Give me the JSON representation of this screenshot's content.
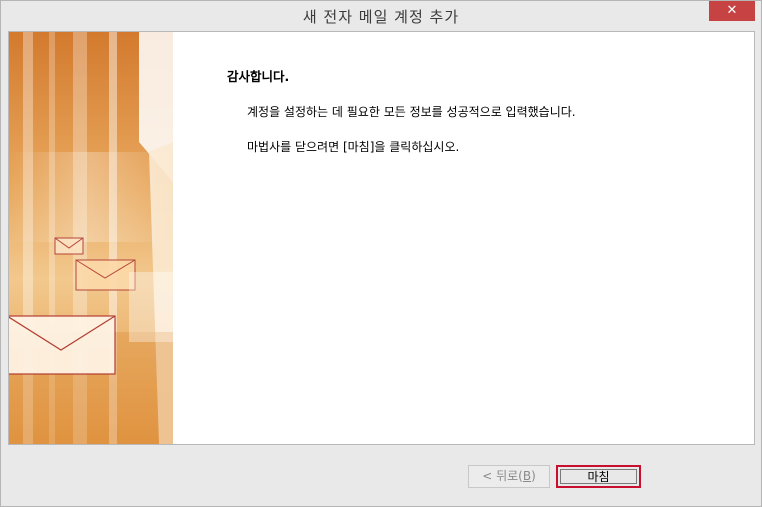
{
  "window": {
    "title": "새 전자 메일 계정 추가",
    "close_glyph": "✕"
  },
  "content": {
    "heading": "감사합니다.",
    "line1": "계정을 설정하는 데 필요한 모든 정보를 성공적으로 입력했습니다.",
    "line2": "마법사를 닫으려면 [마침]을 클릭하십시오."
  },
  "buttons": {
    "back_prefix": "< 뒤로(",
    "back_mnemonic": "B",
    "back_suffix": ")",
    "finish_label": "마침"
  },
  "colors": {
    "accent_border": "#c8102e",
    "close_button": "#c74343",
    "art_orange": "#e8a24a"
  }
}
